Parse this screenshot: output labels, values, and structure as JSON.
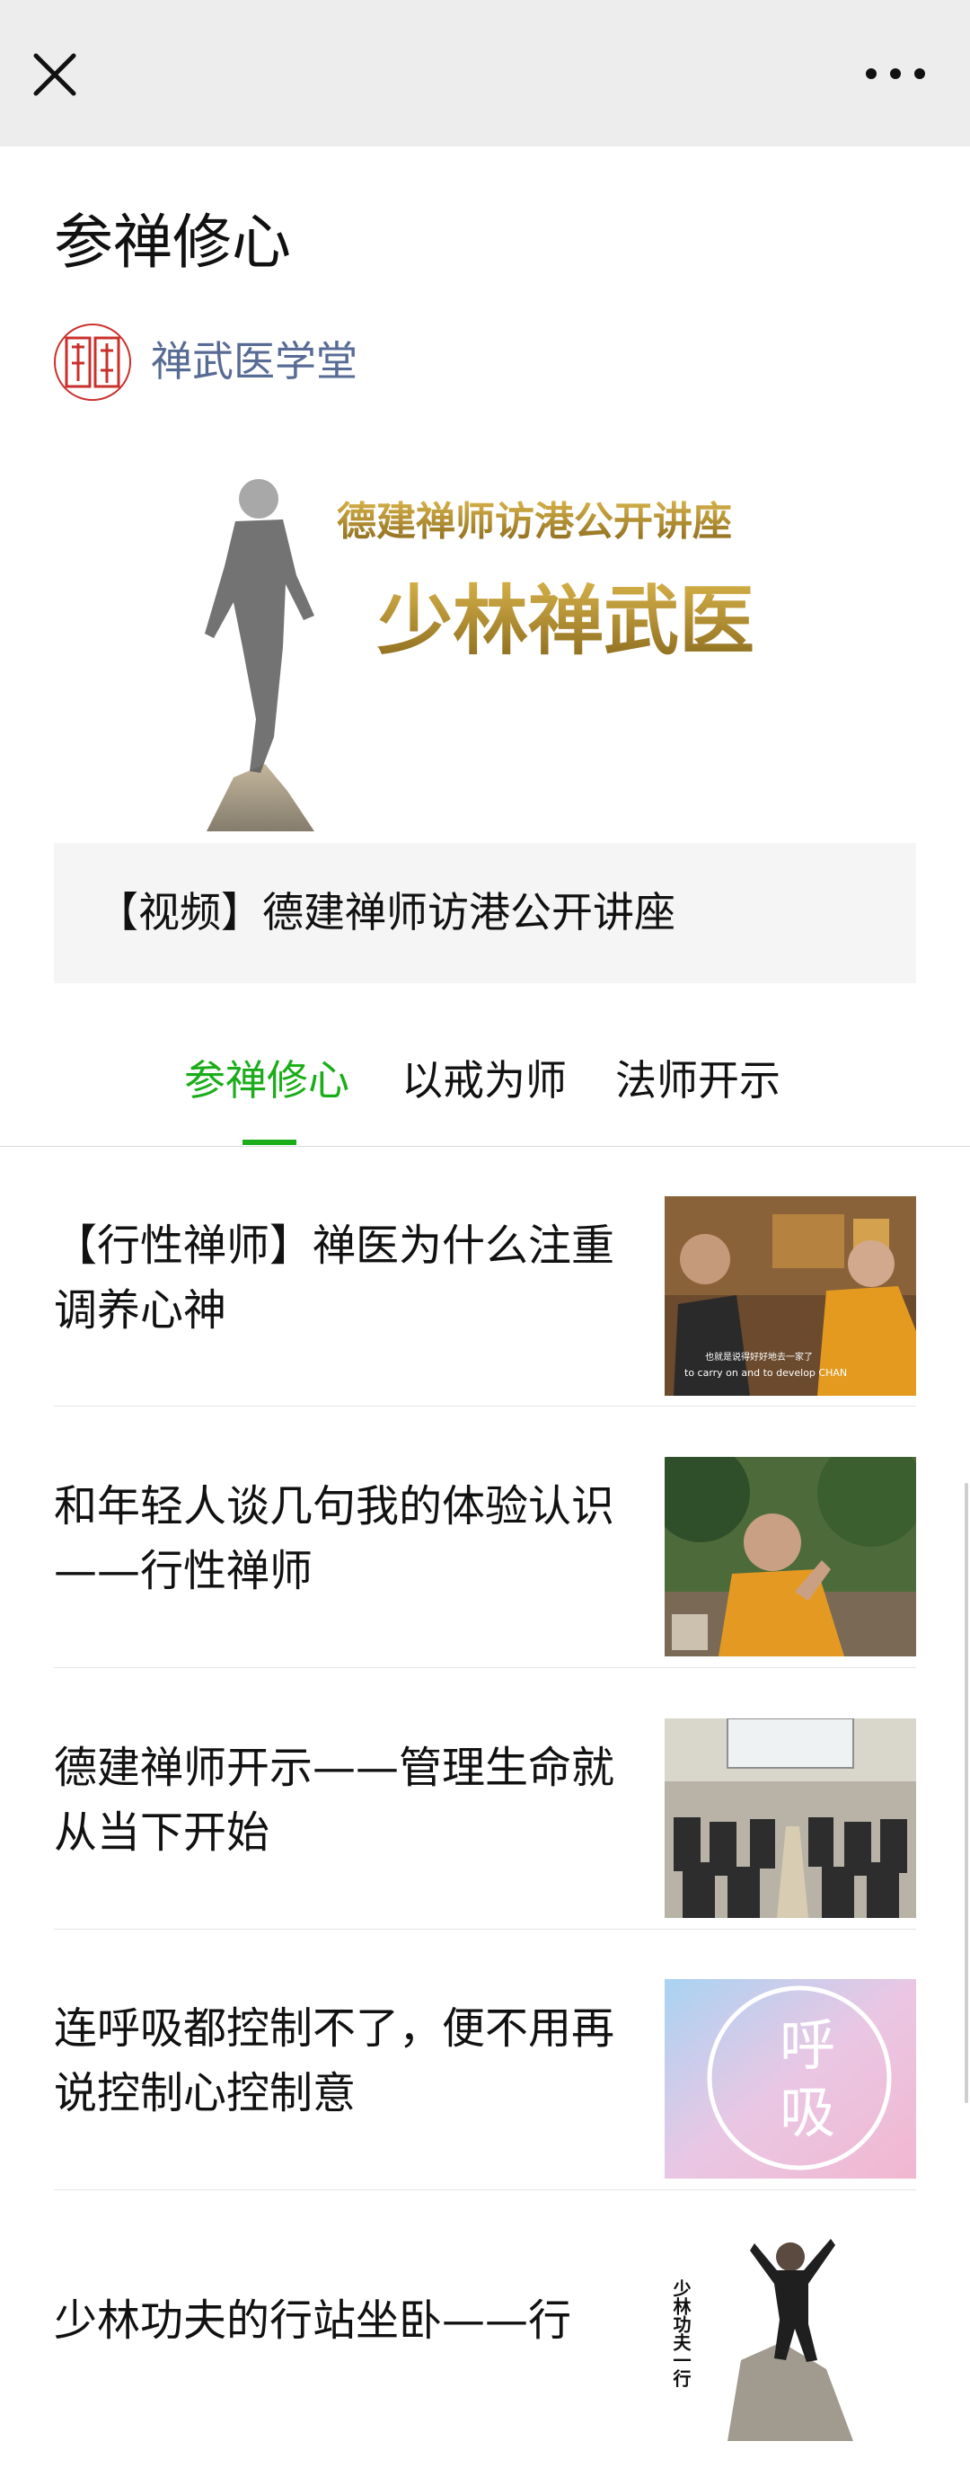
{
  "header": {
    "close_icon": "close-icon",
    "more_icon": "more-dots-icon"
  },
  "article": {
    "title": "参禅修心",
    "author": "禅武医学堂"
  },
  "banner": {
    "line1": "德建禅师访港公开讲座",
    "line2": "少林禅武医"
  },
  "video_card": {
    "label": "【视频】德建禅师访港公开讲座"
  },
  "tabs": [
    {
      "label": "参禅修心",
      "active": true
    },
    {
      "label": "以戒为师",
      "active": false
    },
    {
      "label": "法师开示",
      "active": false
    }
  ],
  "articles": [
    {
      "title": "【行性禅师】禅医为什么注重调养心神",
      "thumb_caption": "to carry on and to develop CHAN"
    },
    {
      "title": "和年轻人谈几句我的体验认识——行性禅师"
    },
    {
      "title": "德建禅师开示——管理生命就从当下开始"
    },
    {
      "title": "连呼吸都控制不了，便不用再说控制心控制意",
      "thumb_text_1": "呼",
      "thumb_text_2": "吸"
    },
    {
      "title": "少林功夫的行站坐卧——行",
      "thumb_vertical_text": "少林功夫一行"
    }
  ],
  "colors": {
    "accent": "#1aad19",
    "link": "#576b95",
    "header_bg": "#ededed"
  }
}
